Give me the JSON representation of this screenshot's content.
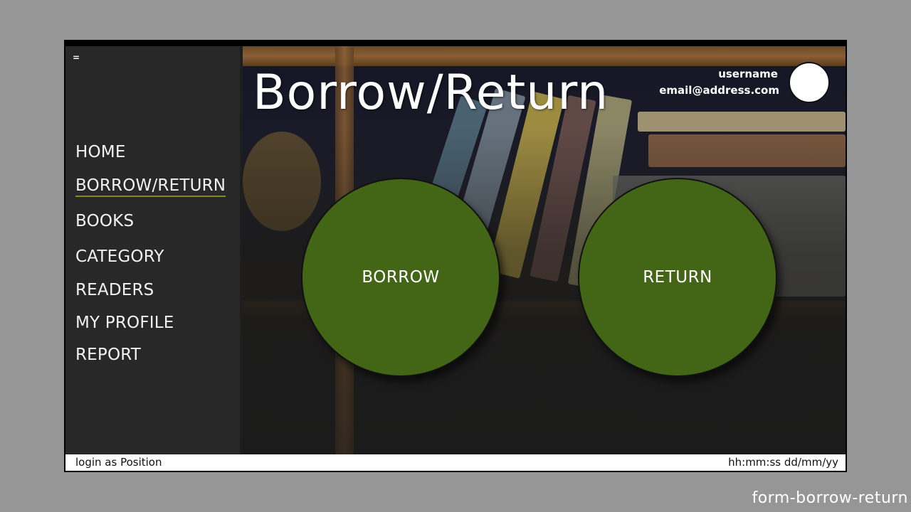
{
  "window": {
    "menu_toggle": "="
  },
  "sidebar": {
    "items": [
      {
        "label": "HOME",
        "active": false
      },
      {
        "label": "BORROW/RETURN",
        "active": true
      },
      {
        "label": "BOOKS",
        "active": false
      },
      {
        "label": "CATEGORY",
        "active": false
      },
      {
        "label": "READERS",
        "active": false
      },
      {
        "label": "MY PROFILE",
        "active": false
      },
      {
        "label": "REPORT",
        "active": false
      }
    ]
  },
  "header": {
    "title": "Borrow/Return",
    "username": "username",
    "email": "email@address.com"
  },
  "actions": {
    "borrow_label": "BORROW",
    "return_label": "RETURN"
  },
  "statusbar": {
    "login_text": "login as Position",
    "datetime": "hh:mm:ss dd/mm/yy"
  },
  "form_name": "form-borrow-return",
  "colors": {
    "background": "#969696",
    "sidebar": "#282828",
    "action_button": "#426516",
    "active_underline": "#8a8a1a"
  },
  "icons": {
    "menu": "hamburger-icon",
    "avatar": "user-avatar-circle"
  }
}
